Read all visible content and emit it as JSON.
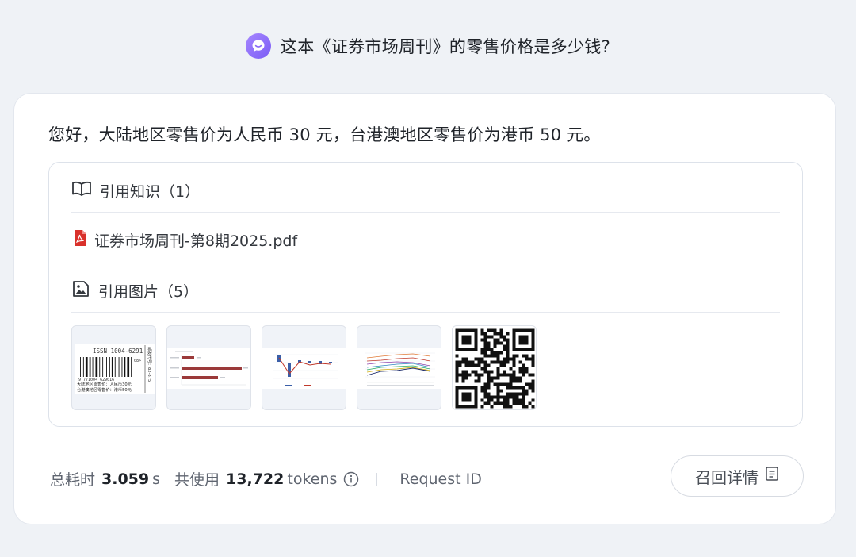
{
  "question": {
    "text": "这本《证券市场周刊》的零售价格是多少钱?"
  },
  "answer": {
    "text": "您好，大陆地区零售价为人民币 30 元，台港澳地区零售价为港币 50 元。"
  },
  "references": {
    "knowledge_title": "引用知识（1）",
    "file_name": "证券市场周刊-第8期2025.pdf",
    "images_title": "引用图片（5）",
    "barcode": {
      "issn": "ISSN 1004-6291",
      "digits": "9 771004 629016",
      "issue": "08>",
      "line1": "大陆地区零售价：人民币30元",
      "line2": "台港澳地区零售价：港币50元",
      "side": "邮发代号：82-875"
    }
  },
  "footer": {
    "time_label": "总耗时",
    "time_value": "3.059",
    "time_unit": "s",
    "tokens_label": "共使用",
    "tokens_value": "13,722",
    "tokens_unit": "tokens",
    "request_id_label": "Request ID",
    "recall_button": "召回详情"
  },
  "colors": {
    "accent_purple": "#8a6cf7",
    "pdf_red": "#d9312b",
    "bar_red": "#9b3a3a"
  }
}
